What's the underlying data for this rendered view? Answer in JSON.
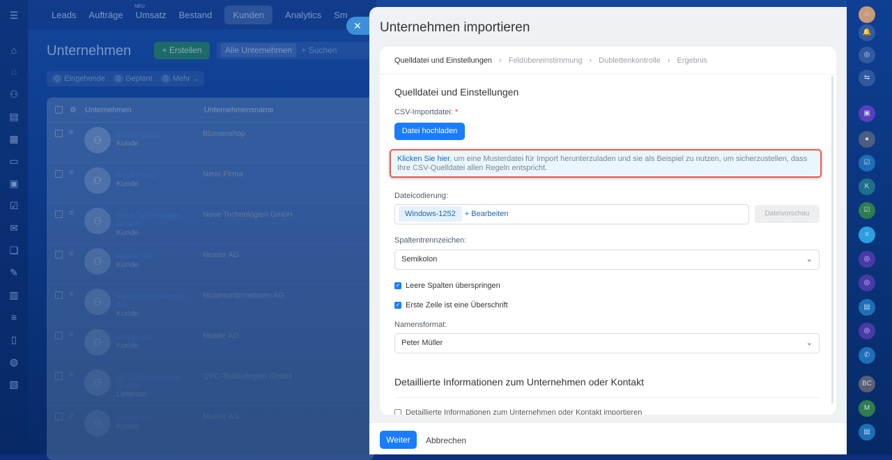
{
  "topnav": {
    "items": [
      "Leads",
      "Aufträge",
      "Umsatz",
      "Bestand",
      "Kunden",
      "Analytics",
      "Sm"
    ],
    "new_badge": "NEU"
  },
  "page": {
    "title": "Unternehmen",
    "create": "+ Erstellen",
    "filter_chip": "Alle Unternehmen",
    "search_placeholder": "+ Suchen",
    "counters": [
      {
        "n": "0",
        "label": "Eingehende"
      },
      {
        "n": "0",
        "label": "Geplant"
      },
      {
        "n": "0",
        "label": "Mehr ⌄"
      }
    ]
  },
  "table": {
    "col1": "Unternehmen",
    "col2": "Unternehmensname",
    "rows": [
      {
        "name": "Blumenshop",
        "type": "Kunde",
        "company": "Blumenshop"
      },
      {
        "name": "Neue Firma",
        "type": "Kunde",
        "company": "Neue Firma"
      },
      {
        "name": "Neue Technologien GmbH",
        "type": "Kunde",
        "company": "Neue Technologien GmbH"
      },
      {
        "name": "Muster AG",
        "type": "Kunde",
        "company": "Muster AG"
      },
      {
        "name": "Musterunternehmen AG",
        "type": "Kunde",
        "company": "Musterunternehmen AG"
      },
      {
        "name": "Muster AG",
        "type": "Kunde",
        "company": "Muster AG"
      },
      {
        "name": "QYC-Technologien GmbH",
        "type": "Lieferant",
        "company": "QYC-Technologien GmbH"
      },
      {
        "name": "Muster AG",
        "type": "Kunde",
        "company": "Muster AG"
      }
    ]
  },
  "panel": {
    "title": "Unternehmen importieren",
    "steps": [
      "Quelldatei und Einstellungen",
      "Feldübereinstimmung",
      "Dublettenkontrolle",
      "Ergebnis"
    ],
    "section_title": "Quelldatei und Einstellungen",
    "csv_label": "CSV-Importdatei:",
    "required": "*",
    "upload": "Datei hochladen",
    "hint_link": "Klicken Sie hier",
    "hint_text": ", um eine Musterdatei für Import herunterzuladen und sie als Beispiel zu nutzen, um sicherzustellen, dass Ihre CSV-Quelldatei allen Regeln entspricht.",
    "encoding_label": "Dateicodierung:",
    "encoding_value": "Windows-1252",
    "encoding_edit": "+ Bearbeiten",
    "preview": "Dateivorschau",
    "separator_label": "Spaltentrennzeichen:",
    "separator_value": "Semikolon",
    "skip_empty": "Leere Spalten überspringen",
    "first_row_header": "Erste Zeile ist eine Überschrift",
    "name_format_label": "Namensformat:",
    "name_format_value": "Peter Müller",
    "detail_title": "Detaillierte Informationen zum Unternehmen oder Kontakt",
    "detail_checkbox": "Detaillierte Informationen zum Unternehmen oder Kontakt importieren",
    "next": "Weiter",
    "cancel": "Abbrechen"
  },
  "rightbar": [
    {
      "icon": "bell-icon",
      "t": "🔔"
    },
    {
      "icon": "openlines-icon",
      "t": "◎"
    },
    {
      "icon": "chat-icon",
      "t": "⇆"
    },
    {
      "icon": "contact-icon",
      "t": "▣",
      "c": "#5a3fc0"
    },
    {
      "icon": "user-avatar",
      "t": "●",
      "c": "#4a5e80"
    },
    {
      "icon": "task-icon",
      "t": "☑",
      "c": "#1e6fb8"
    },
    {
      "text": "K",
      "c": "#1f6f8b"
    },
    {
      "icon": "task-icon",
      "t": "☑",
      "c": "#2e7d4f"
    },
    {
      "icon": "message-icon",
      "t": "≡",
      "c": "#2aa0e0"
    },
    {
      "icon": "openlines-icon",
      "t": "◎",
      "c": "#4a3aa8"
    },
    {
      "icon": "openlines-icon",
      "t": "◎",
      "c": "#4a3aa8"
    },
    {
      "icon": "card-icon",
      "t": "▤",
      "c": "#1e6fb8"
    },
    {
      "icon": "openlines-icon",
      "t": "◎",
      "c": "#4a3aa8"
    },
    {
      "icon": "phone-icon",
      "t": "✆",
      "c": "#1e6fb8"
    },
    {
      "text": "BC",
      "c": "#5a5f75"
    },
    {
      "text": "M",
      "c": "#2e7d4f"
    },
    {
      "icon": "card-icon",
      "t": "▤",
      "c": "#1e6fb8"
    }
  ]
}
